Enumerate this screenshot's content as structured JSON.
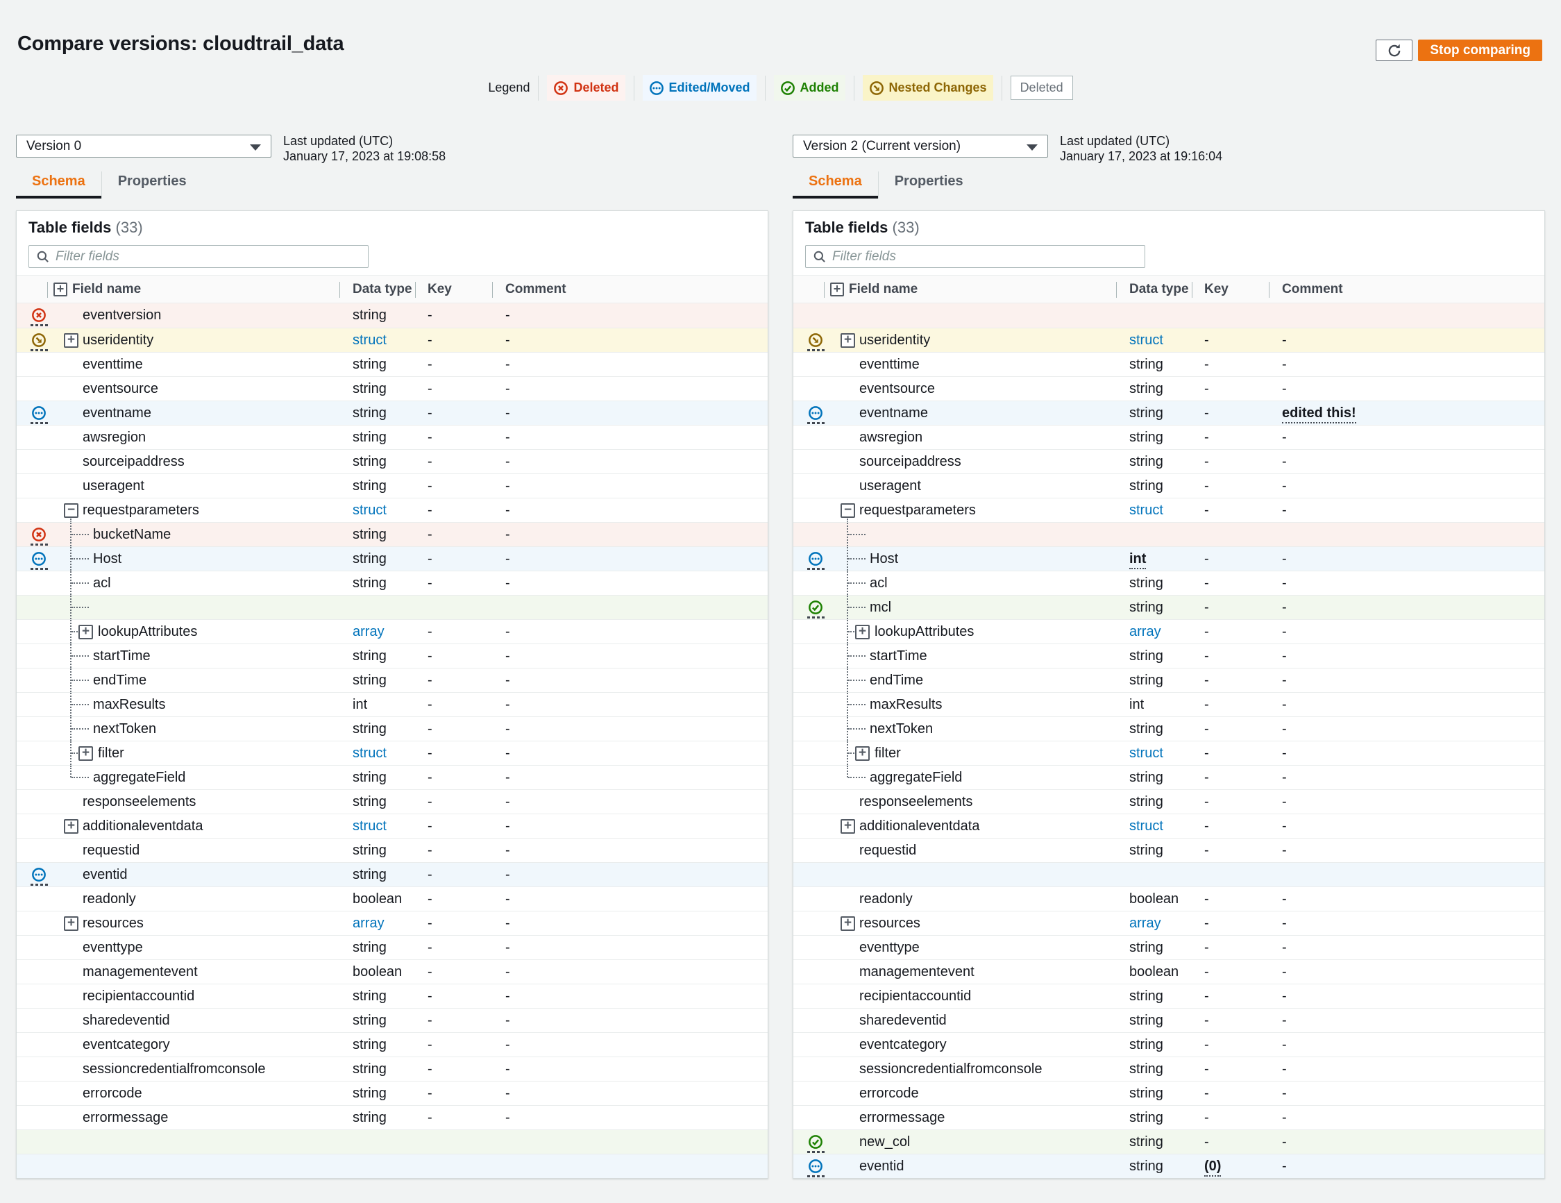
{
  "header": {
    "title": "Compare versions: cloudtrail_data",
    "stop_button": "Stop comparing"
  },
  "legend": {
    "label": "Legend",
    "items": [
      {
        "label": "Deleted",
        "style": "deleted"
      },
      {
        "label": "Edited/Moved",
        "style": "edited"
      },
      {
        "label": "Added",
        "style": "added"
      },
      {
        "label": "Nested Changes",
        "style": "nested"
      },
      {
        "label": "Deleted",
        "style": "plain"
      }
    ]
  },
  "colors": {
    "deleted": "#d13212",
    "edited": "#0073bb",
    "added": "#1d8102",
    "nested": "#8d6605",
    "accent": "#ec7211"
  },
  "panels": [
    {
      "version": "Version 0",
      "updated_label": "Last updated (UTC)",
      "updated_value": "January 17, 2023 at 19:08:58",
      "tabs": [
        "Schema",
        "Properties"
      ],
      "table_title": "Table fields",
      "table_count": "(33)",
      "filter_placeholder": "Filter fields",
      "columns": [
        "Field name",
        "Data type",
        "Key",
        "Comment"
      ],
      "rows": [
        {
          "name": "eventversion",
          "type": "string",
          "key": "-",
          "comment": "-",
          "status": "deleted",
          "bg": "red"
        },
        {
          "name": "useridentity",
          "type": "struct",
          "key": "-",
          "comment": "-",
          "status": "nested",
          "bg": "yellow",
          "expand": "plus"
        },
        {
          "name": "eventtime",
          "type": "string",
          "key": "-",
          "comment": "-"
        },
        {
          "name": "eventsource",
          "type": "string",
          "key": "-",
          "comment": "-"
        },
        {
          "name": "eventname",
          "type": "string",
          "key": "-",
          "comment": "-",
          "status": "edited",
          "bg": "blue"
        },
        {
          "name": "awsregion",
          "type": "string",
          "key": "-",
          "comment": "-"
        },
        {
          "name": "sourceipaddress",
          "type": "string",
          "key": "-",
          "comment": "-"
        },
        {
          "name": "useragent",
          "type": "string",
          "key": "-",
          "comment": "-"
        },
        {
          "name": "requestparameters",
          "type": "struct",
          "key": "-",
          "comment": "-",
          "expand": "minus",
          "guide": "parent"
        },
        {
          "name": "bucketName",
          "type": "string",
          "key": "-",
          "comment": "-",
          "status": "deleted",
          "bg": "red",
          "indent": 1,
          "guide": "leaf"
        },
        {
          "name": "Host",
          "type": "string",
          "key": "-",
          "comment": "-",
          "status": "edited",
          "bg": "blue",
          "indent": 1,
          "guide": "leaf"
        },
        {
          "name": "acl",
          "type": "string",
          "key": "-",
          "comment": "-",
          "indent": 1,
          "guide": "leaf"
        },
        {
          "name": "",
          "type": "",
          "key": "",
          "comment": "",
          "bg": "green",
          "indent": 1,
          "guide": "leaf"
        },
        {
          "name": "lookupAttributes",
          "type": "array",
          "key": "-",
          "comment": "-",
          "indent": 1,
          "expand": "plus",
          "guide": "leaf"
        },
        {
          "name": "startTime",
          "type": "string",
          "key": "-",
          "comment": "-",
          "indent": 1,
          "guide": "leaf"
        },
        {
          "name": "endTime",
          "type": "string",
          "key": "-",
          "comment": "-",
          "indent": 1,
          "guide": "leaf"
        },
        {
          "name": "maxResults",
          "type": "int",
          "key": "-",
          "comment": "-",
          "indent": 1,
          "guide": "leaf"
        },
        {
          "name": "nextToken",
          "type": "string",
          "key": "-",
          "comment": "-",
          "indent": 1,
          "guide": "leaf"
        },
        {
          "name": "filter",
          "type": "struct",
          "key": "-",
          "comment": "-",
          "indent": 1,
          "expand": "plus",
          "guide": "leaf"
        },
        {
          "name": "aggregateField",
          "type": "string",
          "key": "-",
          "comment": "-",
          "indent": 1,
          "guide": "last"
        },
        {
          "name": "responseelements",
          "type": "string",
          "key": "-",
          "comment": "-"
        },
        {
          "name": "additionaleventdata",
          "type": "struct",
          "key": "-",
          "comment": "-",
          "expand": "plus"
        },
        {
          "name": "requestid",
          "type": "string",
          "key": "-",
          "comment": "-"
        },
        {
          "name": "eventid",
          "type": "string",
          "key": "-",
          "comment": "-",
          "status": "edited",
          "bg": "blue"
        },
        {
          "name": "readonly",
          "type": "boolean",
          "key": "-",
          "comment": "-"
        },
        {
          "name": "resources",
          "type": "array",
          "key": "-",
          "comment": "-",
          "expand": "plus"
        },
        {
          "name": "eventtype",
          "type": "string",
          "key": "-",
          "comment": "-"
        },
        {
          "name": "managementevent",
          "type": "boolean",
          "key": "-",
          "comment": "-"
        },
        {
          "name": "recipientaccountid",
          "type": "string",
          "key": "-",
          "comment": "-"
        },
        {
          "name": "sharedeventid",
          "type": "string",
          "key": "-",
          "comment": "-"
        },
        {
          "name": "eventcategory",
          "type": "string",
          "key": "-",
          "comment": "-"
        },
        {
          "name": "sessioncredentialfromconsole",
          "type": "string",
          "key": "-",
          "comment": "-"
        },
        {
          "name": "errorcode",
          "type": "string",
          "key": "-",
          "comment": "-"
        },
        {
          "name": "errormessage",
          "type": "string",
          "key": "-",
          "comment": "-"
        },
        {
          "name": "",
          "type": "",
          "key": "",
          "comment": "",
          "bg": "green"
        },
        {
          "name": "",
          "type": "",
          "key": "",
          "comment": "",
          "bg": "blue"
        }
      ]
    },
    {
      "version": "Version 2 (Current version)",
      "updated_label": "Last updated (UTC)",
      "updated_value": "January 17, 2023 at 19:16:04",
      "tabs": [
        "Schema",
        "Properties"
      ],
      "table_title": "Table fields",
      "table_count": "(33)",
      "filter_placeholder": "Filter fields",
      "columns": [
        "Field name",
        "Data type",
        "Key",
        "Comment"
      ],
      "rows": [
        {
          "name": "",
          "type": "",
          "key": "",
          "comment": "",
          "bg": "red"
        },
        {
          "name": "useridentity",
          "type": "struct",
          "key": "-",
          "comment": "-",
          "status": "nested",
          "bg": "yellow",
          "expand": "plus"
        },
        {
          "name": "eventtime",
          "type": "string",
          "key": "-",
          "comment": "-"
        },
        {
          "name": "eventsource",
          "type": "string",
          "key": "-",
          "comment": "-"
        },
        {
          "name": "eventname",
          "type": "string",
          "key": "-",
          "comment": "edited this!",
          "status": "edited",
          "bg": "blue",
          "emphasis": "comment"
        },
        {
          "name": "awsregion",
          "type": "string",
          "key": "-",
          "comment": "-"
        },
        {
          "name": "sourceipaddress",
          "type": "string",
          "key": "-",
          "comment": "-"
        },
        {
          "name": "useragent",
          "type": "string",
          "key": "-",
          "comment": "-"
        },
        {
          "name": "requestparameters",
          "type": "struct",
          "key": "-",
          "comment": "-",
          "expand": "minus",
          "guide": "parent"
        },
        {
          "name": "",
          "type": "",
          "key": "",
          "comment": "",
          "bg": "red",
          "indent": 1,
          "guide": "leaf"
        },
        {
          "name": "Host",
          "type": "int",
          "key": "-",
          "comment": "-",
          "status": "edited",
          "bg": "blue",
          "indent": 1,
          "guide": "leaf",
          "emphasis": "type"
        },
        {
          "name": "acl",
          "type": "string",
          "key": "-",
          "comment": "-",
          "indent": 1,
          "guide": "leaf"
        },
        {
          "name": "mcl",
          "type": "string",
          "key": "-",
          "comment": "-",
          "status": "added",
          "bg": "green",
          "indent": 1,
          "guide": "leaf"
        },
        {
          "name": "lookupAttributes",
          "type": "array",
          "key": "-",
          "comment": "-",
          "indent": 1,
          "expand": "plus",
          "guide": "leaf"
        },
        {
          "name": "startTime",
          "type": "string",
          "key": "-",
          "comment": "-",
          "indent": 1,
          "guide": "leaf"
        },
        {
          "name": "endTime",
          "type": "string",
          "key": "-",
          "comment": "-",
          "indent": 1,
          "guide": "leaf"
        },
        {
          "name": "maxResults",
          "type": "int",
          "key": "-",
          "comment": "-",
          "indent": 1,
          "guide": "leaf"
        },
        {
          "name": "nextToken",
          "type": "string",
          "key": "-",
          "comment": "-",
          "indent": 1,
          "guide": "leaf"
        },
        {
          "name": "filter",
          "type": "struct",
          "key": "-",
          "comment": "-",
          "indent": 1,
          "expand": "plus",
          "guide": "leaf"
        },
        {
          "name": "aggregateField",
          "type": "string",
          "key": "-",
          "comment": "-",
          "indent": 1,
          "guide": "last"
        },
        {
          "name": "responseelements",
          "type": "string",
          "key": "-",
          "comment": "-"
        },
        {
          "name": "additionaleventdata",
          "type": "struct",
          "key": "-",
          "comment": "-",
          "expand": "plus"
        },
        {
          "name": "requestid",
          "type": "string",
          "key": "-",
          "comment": "-"
        },
        {
          "name": "",
          "type": "",
          "key": "",
          "comment": "",
          "bg": "blue"
        },
        {
          "name": "readonly",
          "type": "boolean",
          "key": "-",
          "comment": "-"
        },
        {
          "name": "resources",
          "type": "array",
          "key": "-",
          "comment": "-",
          "expand": "plus"
        },
        {
          "name": "eventtype",
          "type": "string",
          "key": "-",
          "comment": "-"
        },
        {
          "name": "managementevent",
          "type": "boolean",
          "key": "-",
          "comment": "-"
        },
        {
          "name": "recipientaccountid",
          "type": "string",
          "key": "-",
          "comment": "-"
        },
        {
          "name": "sharedeventid",
          "type": "string",
          "key": "-",
          "comment": "-"
        },
        {
          "name": "eventcategory",
          "type": "string",
          "key": "-",
          "comment": "-"
        },
        {
          "name": "sessioncredentialfromconsole",
          "type": "string",
          "key": "-",
          "comment": "-"
        },
        {
          "name": "errorcode",
          "type": "string",
          "key": "-",
          "comment": "-"
        },
        {
          "name": "errormessage",
          "type": "string",
          "key": "-",
          "comment": "-"
        },
        {
          "name": "new_col",
          "type": "string",
          "key": "-",
          "comment": "-",
          "status": "added",
          "bg": "green"
        },
        {
          "name": "eventid",
          "type": "string",
          "key": "(0)",
          "comment": "-",
          "status": "edited",
          "bg": "blue",
          "emphasis": "key"
        }
      ]
    }
  ]
}
